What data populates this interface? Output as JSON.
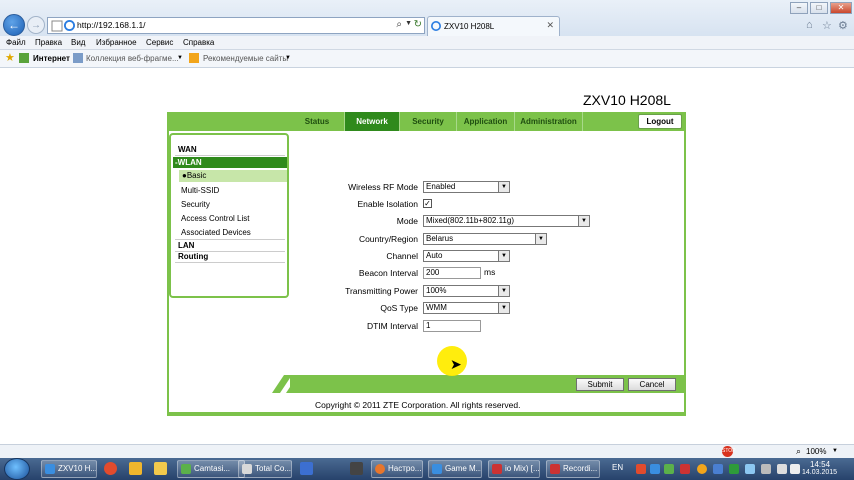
{
  "browser": {
    "url": "http://192.168.1.1/",
    "tab_title": "ZXV10 H208L",
    "menu": [
      "Файл",
      "Правка",
      "Вид",
      "Избранное",
      "Сервис",
      "Справка"
    ],
    "favorites": [
      "Интернет",
      "Коллекция веб-фрагме...",
      "Рекомендуемые сайты"
    ],
    "zoom": "100%"
  },
  "router": {
    "title": "ZXV10 H208L",
    "tabs": [
      "Status",
      "Network",
      "Security",
      "Application",
      "Administration"
    ],
    "active_tab": "Network",
    "logout": "Logout",
    "sidebar": {
      "wan": "WAN",
      "wlan": "-WLAN",
      "basic": "Basic",
      "sub_items": [
        "Multi-SSID",
        "Security",
        "Access Control List",
        "Associated Devices"
      ],
      "lan": "LAN",
      "routing": "Routing"
    },
    "form": {
      "rf_mode_label": "Wireless RF Mode",
      "rf_mode_value": "Enabled",
      "isolation_label": "Enable Isolation",
      "isolation_checked": "✓",
      "mode_label": "Mode",
      "mode_value": "Mixed(802.11b+802.11g)",
      "country_label": "Country/Region",
      "country_value": "Belarus",
      "channel_label": "Channel",
      "channel_value": "Auto",
      "beacon_label": "Beacon Interval",
      "beacon_value": "200",
      "beacon_unit": "ms",
      "power_label": "Transmitting Power",
      "power_value": "100%",
      "qos_label": "QoS Type",
      "qos_value": "WMM",
      "dtim_label": "DTIM Interval",
      "dtim_value": "1"
    },
    "submit": "Submit",
    "cancel": "Cancel",
    "copyright": "Copyright © 2011 ZTE Corporation. All rights reserved."
  },
  "taskbar": {
    "items": [
      "ZXV10 H...",
      "Camtasi...",
      "Total Co...",
      "Настро...",
      "Game M...",
      "io Mix) [...",
      "Recordi..."
    ],
    "lang": "EN",
    "time": "14:54",
    "date": "14.03.2015"
  },
  "colors": {
    "router_green": "#7cc24a",
    "router_dark_green": "#2f8a1c"
  }
}
